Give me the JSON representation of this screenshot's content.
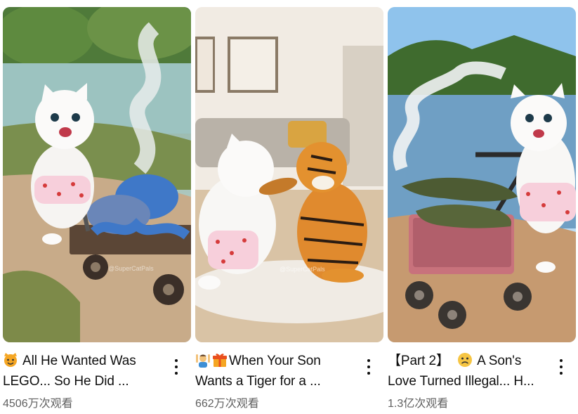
{
  "cards": [
    {
      "title_line1": "All He Wanted Was",
      "title_line2": "LEGO... So He Did ...",
      "views": "4506万次观看",
      "watermark": "@SuperCatPals",
      "icons": [
        "cat-face-emoji"
      ]
    },
    {
      "title_line1": "When Your Son",
      "title_line2": "Wants a Tiger for a ...",
      "views": "662万次观看",
      "watermark": "@SuperCatPals",
      "icons": [
        "person-raising-hands-emoji",
        "gift-emoji"
      ]
    },
    {
      "title_line1_part": "【Part 2】",
      "title_line1_rest": "A Son's",
      "title_line2": "Love Turned Illegal... H...",
      "views": "1.3亿次观看",
      "icons": [
        "sad-face-emoji"
      ]
    }
  ],
  "colors": {
    "title_text": "#0f0f0f",
    "meta_text": "#606060",
    "background": "#ffffff"
  }
}
